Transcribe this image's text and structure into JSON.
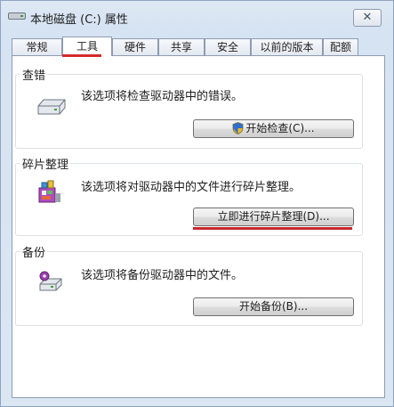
{
  "window": {
    "title": "本地磁盘 (C:) 属性",
    "close_label": "✕"
  },
  "tabs": [
    {
      "label": "常规"
    },
    {
      "label": "工具"
    },
    {
      "label": "硬件"
    },
    {
      "label": "共享"
    },
    {
      "label": "安全"
    },
    {
      "label": "以前的版本"
    },
    {
      "label": "配额"
    }
  ],
  "active_tab": "工具",
  "sections": {
    "error_check": {
      "title": "查错",
      "description": "该选项将检查驱动器中的错误。",
      "button": "开始检查(C)...",
      "icon": "hard-drive-icon"
    },
    "defrag": {
      "title": "碎片整理",
      "description": "该选项将对驱动器中的文件进行碎片整理。",
      "button": "立即进行碎片整理(D)...",
      "icon": "defragment-icon"
    },
    "backup": {
      "title": "备份",
      "description": "该选项将备份驱动器中的文件。",
      "button": "开始备份(B)...",
      "icon": "backup-icon"
    }
  },
  "colors": {
    "highlight": "#d42a2a",
    "tab_border": "#8e9bb1",
    "window_bg": "#dbe6f3"
  }
}
